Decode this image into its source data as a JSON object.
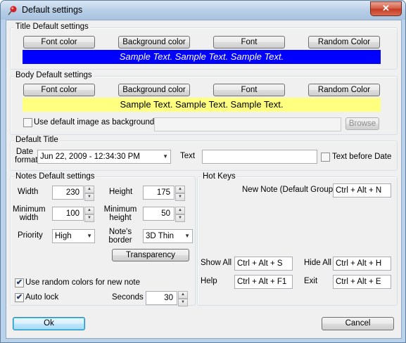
{
  "window": {
    "title": "Default settings",
    "close_glyph": "✕"
  },
  "title_settings": {
    "label": "Title Default settings",
    "buttons": [
      "Font color",
      "Background color",
      "Font",
      "Random Color"
    ],
    "sample_text": "Sample Text. Sample Text. Sample Text.",
    "sample_bg": "#0000ff",
    "sample_fg": "#ffffff"
  },
  "body_settings": {
    "label": "Body Default settings",
    "buttons": [
      "Font color",
      "Background color",
      "Font",
      "Random Color"
    ],
    "sample_text": "Sample Text. Sample Text. Sample Text.",
    "sample_bg": "#ffff80",
    "sample_fg": "#000000",
    "use_image_label": "Use default image as background",
    "use_image_checked": false,
    "image_path": "",
    "browse_label": "Browse"
  },
  "default_title": {
    "label": "Default Title",
    "date_format_label": "Date format",
    "date_value": "Jun 22, 2009 - 12:34:30 PM",
    "text_label": "Text",
    "text_value": "",
    "text_before_date_label": "Text before Date",
    "text_before_date_checked": false
  },
  "notes_settings": {
    "label": "Notes Default settings",
    "width_label": "Width",
    "width_value": "230",
    "height_label": "Height",
    "height_value": "175",
    "min_width_label": "Minimum width",
    "min_width_value": "100",
    "min_height_label": "Minimum height",
    "min_height_value": "50",
    "priority_label": "Priority",
    "priority_value": "High",
    "border_label": "Note's border",
    "border_value": "3D Thin",
    "transparency_label": "Transparency",
    "random_colors_label": "Use random colors for new note",
    "random_colors_checked": true,
    "auto_lock_label": "Auto lock",
    "auto_lock_checked": true,
    "seconds_label": "Seconds",
    "seconds_value": "30"
  },
  "hot_keys": {
    "label": "Hot Keys",
    "new_note_label": "New Note (Default Group)",
    "new_note_value": "Ctrl + Alt + N",
    "show_all_label": "Show All",
    "show_all_value": "Ctrl + Alt + S",
    "hide_all_label": "Hide All",
    "hide_all_value": "Ctrl + Alt + H",
    "help_label": "Help",
    "help_value": "Ctrl + Alt + F1",
    "exit_label": "Exit",
    "exit_value": "Ctrl + Alt + E"
  },
  "footer": {
    "ok_label": "Ok",
    "cancel_label": "Cancel"
  },
  "icons": {
    "app": "pushpin-icon",
    "check": "✔",
    "spin_up": "▲",
    "spin_down": "▼",
    "dropdown": "▼"
  }
}
